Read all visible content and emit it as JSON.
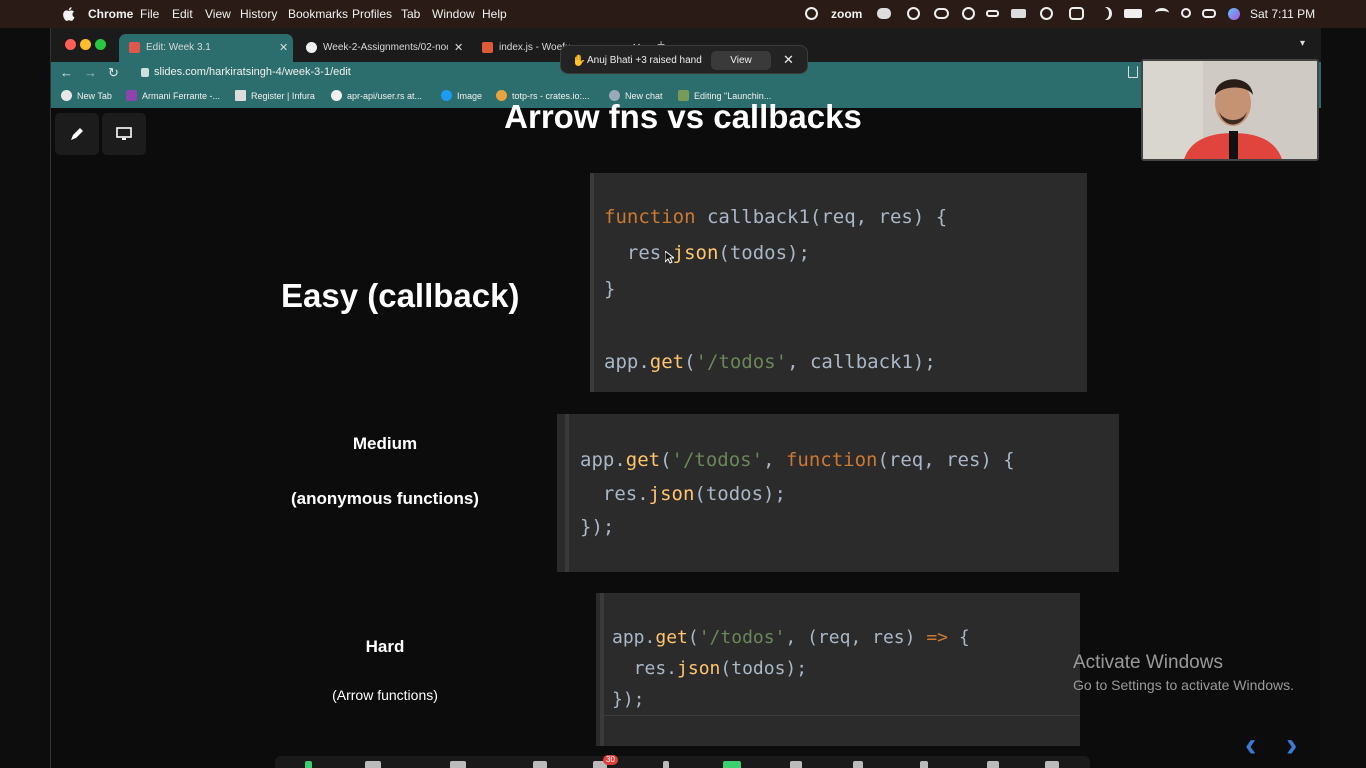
{
  "menubar": {
    "app_name": "Chrome",
    "items": [
      "File",
      "Edit",
      "View",
      "History",
      "Bookmarks",
      "Profiles",
      "Tab",
      "Window",
      "Help"
    ],
    "zoom_label": "zoom",
    "clock": "Sat 7:11 PM"
  },
  "browser": {
    "tabs": [
      {
        "title": "Edit: Week 3.1",
        "active": true
      },
      {
        "title": "Week-2-Assignments/02-nod",
        "active": false
      },
      {
        "title": "index.js - Woefu",
        "active": false
      }
    ],
    "url": "slides.com/harkiratsingh-4/week-3-1/edit",
    "bookmarks": [
      "New Tab",
      "Armani Ferrante -...",
      "Register | Infura",
      "apr-api/user.rs at...",
      "Image",
      "totp-rs - crates.io:...",
      "New chat",
      "Editing \"Launchin..."
    ]
  },
  "toast": {
    "message": "Anuj Bhati +3 raised hand",
    "view_label": "View"
  },
  "slide": {
    "title": "Arrow fns vs callbacks",
    "easy_label": "Easy (callback)",
    "medium_label": "Medium",
    "medium_sub": "(anonymous functions)",
    "hard_label": "Hard",
    "hard_sub": "(Arrow functions)"
  },
  "code": {
    "easy": {
      "l1_kw": "function",
      "l1_rest": " callback1(req, res) {",
      "l2_a": "  res.",
      "l2_fn": "json",
      "l2_b": "(todos);",
      "l3": "}",
      "l4_a": "app.",
      "l4_fn": "get",
      "l4_b": "(",
      "l4_str": "'/todos'",
      "l4_c": ", callback1);"
    },
    "medium": {
      "l1_a": "app.",
      "l1_fn": "get",
      "l1_b": "(",
      "l1_str": "'/todos'",
      "l1_c": ", ",
      "l1_kw": "function",
      "l1_d": "(req, res) {",
      "l2_a": "  res.",
      "l2_fn": "json",
      "l2_b": "(todos);",
      "l3": "});"
    },
    "hard": {
      "l1_a": "app.",
      "l1_fn": "get",
      "l1_b": "(",
      "l1_str": "'/todos'",
      "l1_c": ", (req, res) ",
      "l1_kw": "=>",
      "l1_d": " {",
      "l2_a": "  res.",
      "l2_fn": "json",
      "l2_b": "(todos);",
      "l3": "});"
    }
  },
  "watermark": {
    "line1": "Activate Windows",
    "line2": "Go to Settings to activate Windows."
  },
  "zoombar": {
    "participants_badge": "30"
  },
  "colors": {
    "address_bar": "#2c6e6e",
    "menubar": "#2a1b16",
    "keyword": "#cc7832",
    "function": "#ffc66d",
    "string": "#6a8759",
    "nav_arrow": "#3a7bd5"
  }
}
